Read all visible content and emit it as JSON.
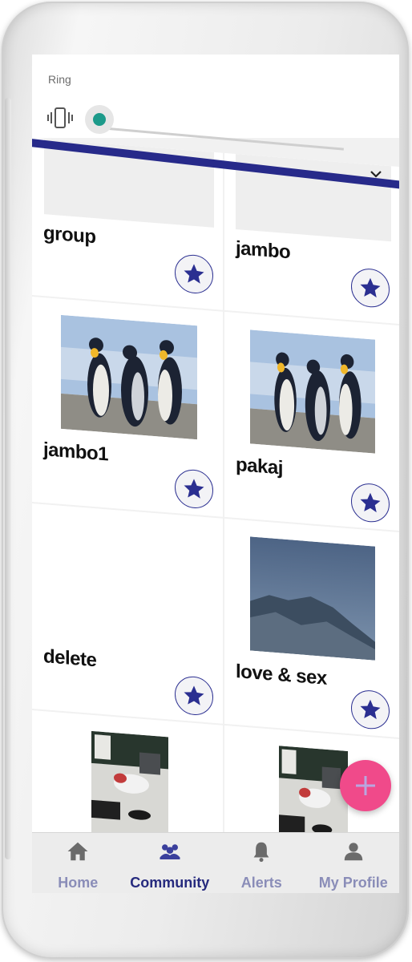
{
  "volume_panel": {
    "label": "Ring",
    "level_fraction": 0.0
  },
  "cards": [
    {
      "title": "group",
      "image": "placeholder",
      "starred": true
    },
    {
      "title": "jambo",
      "image": "placeholder",
      "starred": true
    },
    {
      "title": "jambo1",
      "image": "penguins",
      "starred": true
    },
    {
      "title": "pakaj",
      "image": "penguins",
      "starred": true
    },
    {
      "title": "delete",
      "image": "none",
      "starred": true
    },
    {
      "title": "love & sex",
      "image": "mountains",
      "starred": true
    },
    {
      "title": "",
      "image": "desk-photo",
      "starred": false
    },
    {
      "title": "",
      "image": "desk-photo",
      "starred": false
    }
  ],
  "bottom_nav": {
    "items": [
      {
        "label": "Home",
        "icon": "home-icon",
        "active": false
      },
      {
        "label": "Community",
        "icon": "community-icon",
        "active": true
      },
      {
        "label": "Alerts",
        "icon": "bell-icon",
        "active": false
      },
      {
        "label": "My Profile",
        "icon": "profile-icon",
        "active": false
      }
    ]
  },
  "colors": {
    "primary": "#272a8a",
    "accent_fab": "#f04a8a",
    "slider": "#1c9a8a"
  }
}
